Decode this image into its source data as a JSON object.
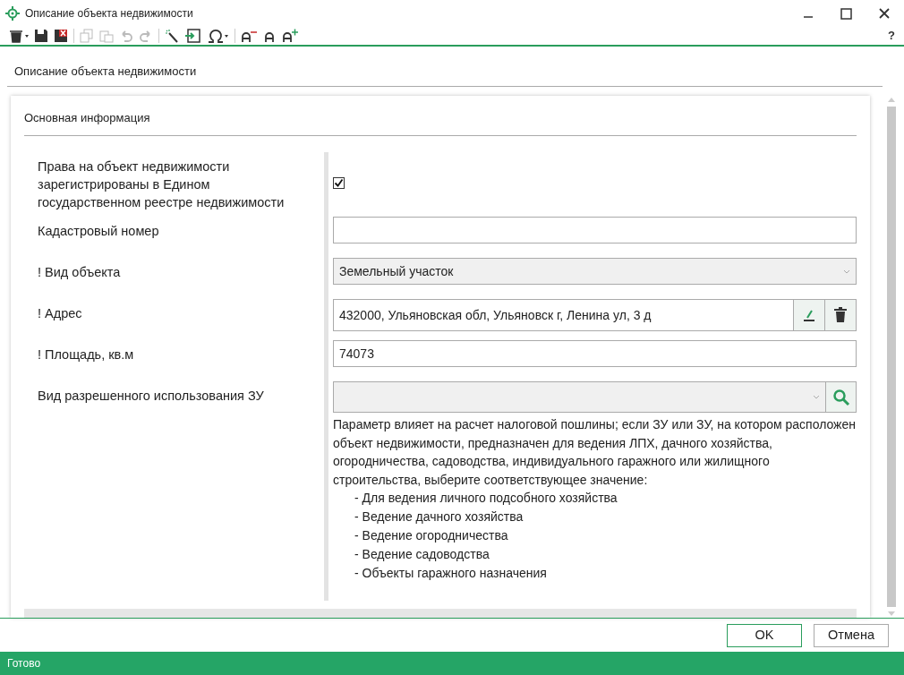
{
  "window": {
    "title": "Описание объекта недвижимости"
  },
  "toolbar": {
    "help": "?"
  },
  "page_title": "Описание объекта недвижимости",
  "section": {
    "title": "Основная информация",
    "fields": [
      {
        "kind": "checkbox",
        "label": "Права на объект недвижимости зарегистрированы в Едином государственном реестре недвижимости",
        "checked": true
      },
      {
        "kind": "text",
        "label": "Кадастровый номер"
      },
      {
        "kind": "select",
        "label": "! Вид объекта",
        "value": "Земельный участок"
      },
      {
        "kind": "address",
        "label": "! Адрес",
        "value": "432000, Ульяновская обл, Ульяновск г, Ленина ул, 3 д"
      },
      {
        "kind": "text",
        "label": "! Площадь, кв.м",
        "value": "74073"
      },
      {
        "kind": "lookup",
        "label": "Вид разрешенного использования ЗУ",
        "hint": "Параметр влияет на расчет налоговой пошлины; если ЗУ или ЗУ, на котором расположен объект недвижимости, предназначен для ведения ЛПХ, дачного хозяйства, огородничества, садоводства, индивидуального гаражного или жилищного строительства, выберите соответствующее значение:",
        "hint_items": [
          "- Для ведения личного подсобного хозяйства",
          "- Ведение дачного хозяйства",
          "- Ведение огородничества",
          "- Ведение садоводства",
          "- Объекты гаражного назначения"
        ]
      }
    ]
  },
  "buttons": [
    {
      "label": "OK",
      "default": true
    },
    {
      "label": "Отмена",
      "default": false
    }
  ],
  "status_bar": "Готово"
}
